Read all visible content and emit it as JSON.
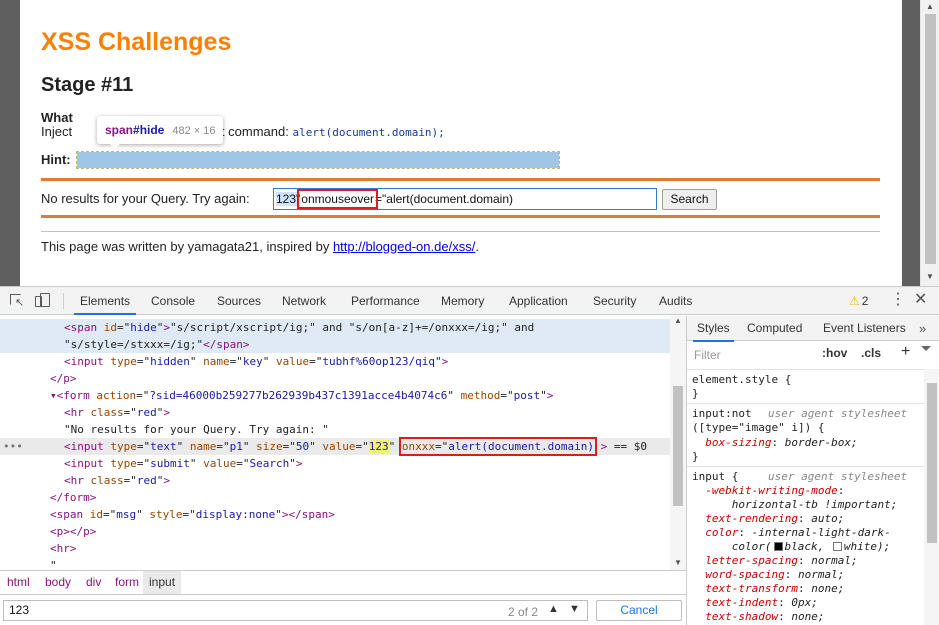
{
  "page": {
    "title": "XSS Challenges",
    "stage": "Stage #11",
    "what_label": "What",
    "what_suffix": "to",
    "inject_prefix": "Inject",
    "inject_suffix": "pt command:",
    "inject_code": "alert(document.domain);",
    "hint_label": "Hint:",
    "query_text": "No results for your Query. Try again:",
    "input_prefix": "123\"",
    "input_boxed": "onmouseover",
    "input_suffix": "=\"alert(document.domain)",
    "search_button": "Search",
    "footer_text": "This page was written by yamagata21, inspired by ",
    "footer_link": "http://blogged-on.de/xss/",
    "footer_end": "."
  },
  "tooltip": {
    "tag": "span",
    "id": "#hide",
    "size": "482 × 16"
  },
  "devtools": {
    "tabs": [
      "Elements",
      "Console",
      "Sources",
      "Network",
      "Performance",
      "Memory",
      "Application",
      "Security",
      "Audits"
    ],
    "active_tab": "Elements",
    "warnings": "2",
    "elements": [
      {
        "html": "<span class=\"tg\">&lt;b&gt;</span><span class=\"tx\">Hint:</span><span class=\"tg\">&lt;/b&gt;</span>"
      },
      {
        "html": "<span class=\"tg\">&lt;span</span> <span class=\"an\">id</span>=\"<span class=\"av\">hide</span>\"<span class=\"tg\">&gt;</span><span class=\"tx\">\"s/script/xscript/ig;\" and \"s/on[a-z]+=/onxxx=/ig;\" and</span>"
      },
      {
        "html": "<span class=\"tx\">\"s/style=/stxxx=/ig;\"</span><span class=\"tg\">&lt;/span&gt;</span>"
      },
      {
        "html": "<span class=\"tg\">&lt;input</span> <span class=\"an\">type</span>=\"<span class=\"av\">hidden</span>\" <span class=\"an\">name</span>=\"<span class=\"av\">key</span>\" <span class=\"an\">value</span>=\"<span class=\"av\">tubhf%60op123/qiq</span>\"<span class=\"tg\">&gt;</span>"
      },
      {
        "html": "<span class=\"tg\">&lt;/p&gt;</span>"
      },
      {
        "html": "<span class=\"tg\">▾&lt;form</span> <span class=\"an\">action</span>=\"<span class=\"av\">?sid=46000b259277b262939b437c1391acce4b4074c6</span>\" <span class=\"an\">method</span>=\"<span class=\"av\">post</span>\"<span class=\"tg\">&gt;</span>"
      },
      {
        "html": "<span class=\"tg\">&lt;hr</span> <span class=\"an\">class</span>=\"<span class=\"av\">red</span>\"<span class=\"tg\">&gt;</span>"
      },
      {
        "html": "<span class=\"tx\">\"No results for your Query. Try again: \"</span>"
      },
      {
        "html": "<span class=\"tg\">&lt;input</span> <span class=\"an\">type</span>=\"<span class=\"av\">text</span>\" <span class=\"an\">name</span>=\"<span class=\"av\">p1</span>\" <span class=\"an\">size</span>=\"<span class=\"av\">50</span>\" <span class=\"an\">value</span>=\"<span class=\"av hlval\">123</span>\" <span class=\"boxed\"> <span class=\"an\">onxxx</span>=\"<span class=\"av\">alert(document.domain)</span></span> <span class=\"tg\">&gt;</span> == $0"
      },
      {
        "html": "<span class=\"tg\">&lt;input</span> <span class=\"an\">type</span>=\"<span class=\"av\">submit</span>\" <span class=\"an\">value</span>=\"<span class=\"av\">Search</span>\"<span class=\"tg\">&gt;</span>"
      },
      {
        "html": "<span class=\"tg\">&lt;hr</span> <span class=\"an\">class</span>=\"<span class=\"av\">red</span>\"<span class=\"tg\">&gt;</span>"
      },
      {
        "html": "<span class=\"tg\">&lt;/form&gt;</span>"
      },
      {
        "html": "<span class=\"tg\">&lt;span</span> <span class=\"an\">id</span>=\"<span class=\"av\">msg</span>\" <span class=\"an\">style</span>=\"<span class=\"av\">display:none</span>\"<span class=\"tg\">&gt;&lt;/span&gt;</span>"
      },
      {
        "html": "<span class=\"tg\">&lt;p&gt;&lt;/p&gt;</span>"
      },
      {
        "html": "<span class=\"tg\">&lt;hr&gt;</span>"
      },
      {
        "html": "<span class=\"tx\">\"</span>"
      }
    ],
    "breadcrumbs": [
      "html",
      "body",
      "div",
      "form",
      "input"
    ],
    "find": {
      "value": "123",
      "count": "2 of 2",
      "cancel": "Cancel"
    },
    "styles": {
      "tabs": [
        "Styles",
        "Computed",
        "Event Listeners"
      ],
      "more": "»",
      "filter_placeholder": "Filter",
      "hov": ":hov",
      "cls": ".cls",
      "plus": "+",
      "element_style": "element.style {",
      "rule1_selector": "input:not",
      "rule1_selector2": "([type=\"image\" i]) {",
      "rule1_source": "user agent stylesheet",
      "rule1_prop": "box-sizing",
      "rule1_val": "border-box;",
      "rule2_selector": "input {",
      "rule2_source": "user agent stylesheet",
      "props": [
        {
          "p": "-webkit-writing-mode",
          "v": ""
        },
        {
          "p": "",
          "v": "horizontal-tb !important;"
        },
        {
          "p": "text-rendering",
          "v": "auto;"
        },
        {
          "p": "color",
          "v": "-internal-light-dark-"
        },
        {
          "p": "",
          "v": "color(■black, □white);"
        },
        {
          "p": "letter-spacing",
          "v": "normal;"
        },
        {
          "p": "word-spacing",
          "v": "normal;"
        },
        {
          "p": "text-transform",
          "v": "none;"
        },
        {
          "p": "text-indent",
          "v": "0px;"
        },
        {
          "p": "text-shadow",
          "v": "none;"
        }
      ],
      "close_brace": "}"
    }
  }
}
